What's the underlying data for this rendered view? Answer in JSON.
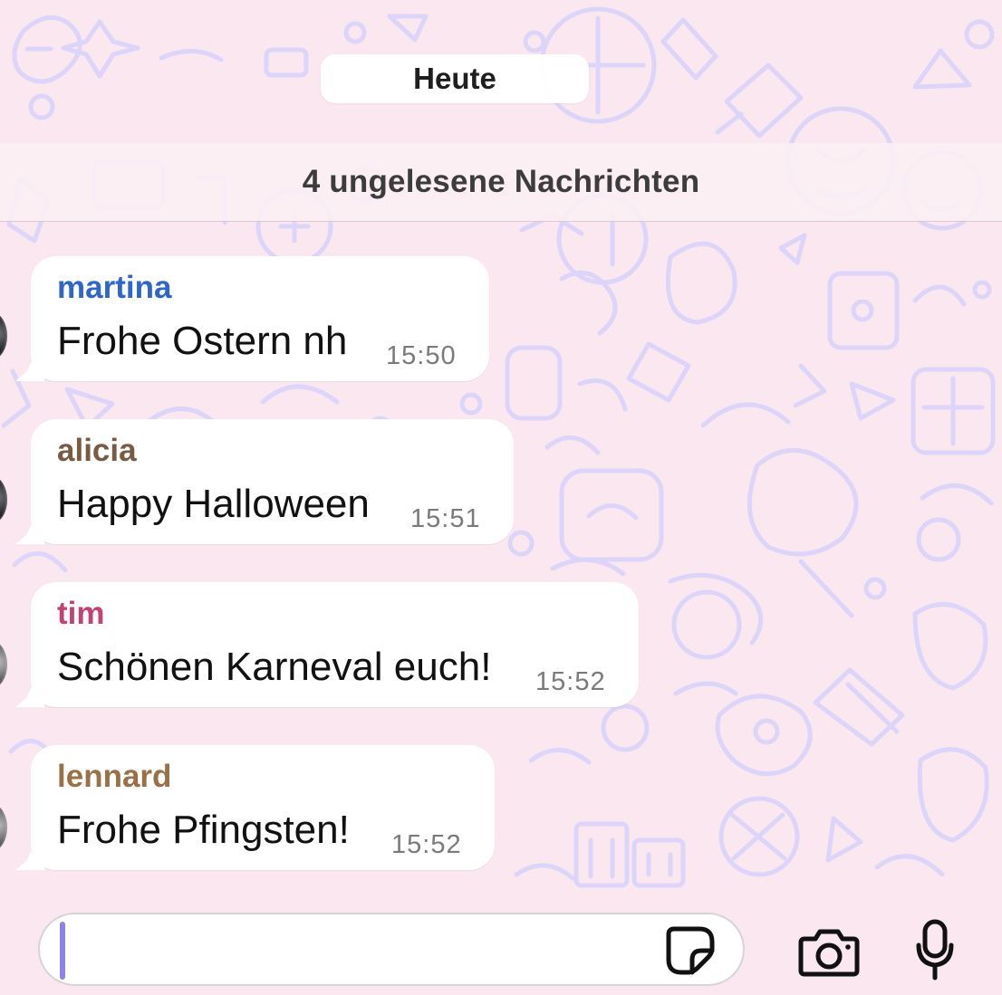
{
  "chat": {
    "date_label": "Heute",
    "unread_label": "4 ungelesene Nachrichten",
    "messages": [
      {
        "sender": "martina",
        "text": "Frohe Ostern nh",
        "time": "15:50",
        "sender_color": "#2f67c7"
      },
      {
        "sender": "alicia",
        "text": "Happy Halloween",
        "time": "15:51",
        "sender_color": "#7a5a43"
      },
      {
        "sender": "tim",
        "text": "Schönen Karneval euch!",
        "time": "15:52",
        "sender_color": "#c04371"
      },
      {
        "sender": "lennard",
        "text": "Frohe Pfingsten!",
        "time": "15:52",
        "sender_color": "#9a7046"
      }
    ]
  },
  "composer": {
    "icons": {
      "sticker": "sticker-icon",
      "camera": "camera-icon",
      "mic": "microphone-icon"
    }
  }
}
